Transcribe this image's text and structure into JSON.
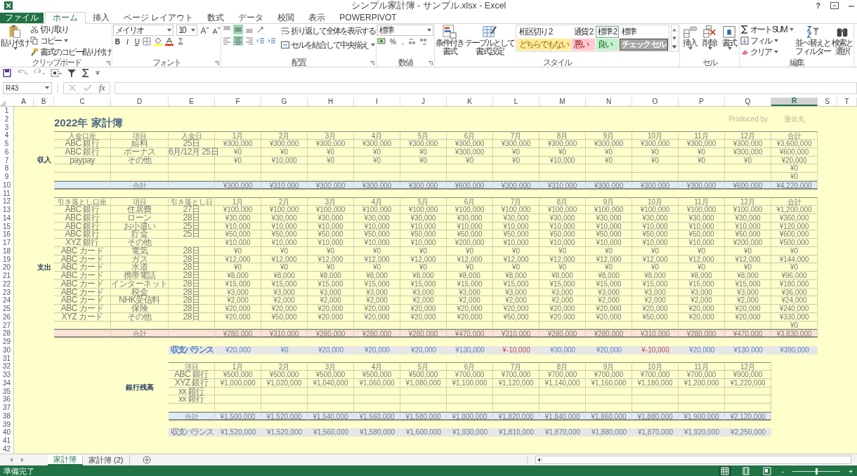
{
  "window": {
    "title": "シンプル家計簿 - サンプル.xlsx - Excel",
    "help": "?"
  },
  "ribbon_tabs": [
    {
      "label": "ファイル",
      "kind": "file",
      "selected": false
    },
    {
      "label": "ホーム",
      "kind": "tab",
      "selected": true
    },
    {
      "label": "挿入",
      "kind": "tab",
      "selected": false
    },
    {
      "label": "ページ レイアウト",
      "kind": "tab",
      "selected": false
    },
    {
      "label": "数式",
      "kind": "tab",
      "selected": false
    },
    {
      "label": "データ",
      "kind": "tab",
      "selected": false
    },
    {
      "label": "校閲",
      "kind": "tab",
      "selected": false
    },
    {
      "label": "表示",
      "kind": "tab",
      "selected": false
    },
    {
      "label": "POWERPIVOT",
      "kind": "tab",
      "selected": false
    }
  ],
  "ribbon": {
    "clipboard": {
      "label": "クリップボード",
      "paste": "貼り付け",
      "cut": "切り取り",
      "copy": "コピー",
      "format_painter": "書式のコピー/貼り付け"
    },
    "font": {
      "label": "フォント",
      "name": "メイリオ",
      "size": "10",
      "bold": "B",
      "italic": "I",
      "underline": "U"
    },
    "alignment": {
      "label": "配置",
      "middle_selected": true,
      "center_selected": true,
      "wrap": "折り返して全体を表示する",
      "merge": "セルを結合して中央揃え"
    },
    "number": {
      "label": "数値",
      "format": "標準",
      "percent": "%",
      "comma": ","
    },
    "styles": {
      "label": "スタイル",
      "conditional": [
        "条件付き",
        "書式"
      ],
      "table": [
        "テーブルとして",
        "書式設定"
      ],
      "gallery": [
        {
          "label": "桁区切り 2",
          "kind": "plain",
          "selected": false
        },
        {
          "label": "通貨 2",
          "kind": "plain",
          "selected": false
        },
        {
          "label": "標準 2",
          "kind": "plain",
          "selected": true
        },
        {
          "label": "標準",
          "kind": "plain",
          "selected": false
        },
        {
          "label": "どちらでもない",
          "kind": "neutral",
          "selected": false
        },
        {
          "label": "悪い",
          "kind": "bad",
          "selected": false
        },
        {
          "label": "良い",
          "kind": "good",
          "selected": false
        },
        {
          "label": "チェック セル",
          "kind": "check",
          "selected": false
        }
      ]
    },
    "cells": {
      "label": "セル",
      "insert": "挿入",
      "delete": "削除",
      "format": "書式"
    },
    "editing": {
      "label": "編集",
      "autosum": "オート SUM",
      "fill": "フィル",
      "clear": "クリア",
      "sort": [
        "並べ替えと",
        "フィルター"
      ],
      "find": [
        "検索と",
        "選択"
      ]
    }
  },
  "formula_bar": {
    "name_box": "R43",
    "fx": "fx"
  },
  "column_headers": [
    {
      "label": "A",
      "selected": false
    },
    {
      "label": "B",
      "selected": false
    },
    {
      "label": "C",
      "selected": false
    },
    {
      "label": "D",
      "selected": false
    },
    {
      "label": "E",
      "selected": false
    },
    {
      "label": "F",
      "selected": false
    },
    {
      "label": "G",
      "selected": false
    },
    {
      "label": "H",
      "selected": false
    },
    {
      "label": "I",
      "selected": false
    },
    {
      "label": "J",
      "selected": false
    },
    {
      "label": "K",
      "selected": false
    },
    {
      "label": "L",
      "selected": false
    },
    {
      "label": "M",
      "selected": false
    },
    {
      "label": "N",
      "selected": false
    },
    {
      "label": "O",
      "selected": false
    },
    {
      "label": "P",
      "selected": false
    },
    {
      "label": "Q",
      "selected": false
    },
    {
      "label": "R",
      "selected": true
    },
    {
      "label": "S",
      "selected": false
    },
    {
      "label": "T",
      "selected": false
    }
  ],
  "row_headers": [
    "1",
    "2",
    "3",
    "4",
    "5",
    "6",
    "7",
    "8",
    "9",
    "10",
    "11",
    "12",
    "13",
    "14",
    "15",
    "16",
    "17",
    "18",
    "19",
    "20",
    "21",
    "22",
    "23",
    "24",
    "25",
    "26",
    "27",
    "28",
    "29",
    "30",
    "31",
    "32",
    "33",
    "34",
    "35",
    "36",
    "37",
    "38",
    "39",
    "40",
    "41",
    "42"
  ],
  "sheet": {
    "title": "2022年 家計簿",
    "credit": [
      "Produced by",
      "蓮佑丸"
    ],
    "income": {
      "label": "収入",
      "columns": [
        "入金口座",
        "項目",
        "入金日",
        "1月",
        "2月",
        "3月",
        "4月",
        "5月",
        "6月",
        "7月",
        "8月",
        "9月",
        "10月",
        "11月",
        "12月",
        "合計"
      ],
      "rows": [
        {
          "account": "ABC 銀行",
          "item": "給料",
          "date": "25日",
          "months": [
            "¥300,000",
            "¥300,000",
            "¥300,000",
            "¥300,000",
            "¥300,000",
            "¥300,000",
            "¥300,000",
            "¥300,000",
            "¥300,000",
            "¥300,000",
            "¥300,000",
            "¥300,000"
          ],
          "total": "¥3,600,000"
        },
        {
          "account": "ABC 銀行",
          "item": "ボーナス",
          "date": "6月/12月 25日",
          "months": [
            "¥0",
            "¥0",
            "¥0",
            "¥0",
            "¥0",
            "¥300,000",
            "¥0",
            "¥0",
            "¥0",
            "¥0",
            "¥0",
            "¥300,000"
          ],
          "total": "¥600,000"
        },
        {
          "account": "paypay",
          "item": "その他",
          "months": [
            "¥0",
            "¥10,000",
            "¥0",
            "¥0",
            "¥0",
            "¥0",
            "¥0",
            "¥10,000",
            "¥0",
            "¥0",
            "¥0",
            "¥0"
          ],
          "total": "¥20,000"
        },
        {
          "total": "¥0"
        },
        {
          "total": "¥0"
        }
      ],
      "total": {
        "item": "合計",
        "months": [
          "¥300,000",
          "¥310,000",
          "¥300,000",
          "¥300,000",
          "¥300,000",
          "¥600,000",
          "¥300,000",
          "¥310,000",
          "¥300,000",
          "¥300,000",
          "¥300,000",
          "¥600,000"
        ],
        "total": "¥4,220,000"
      }
    },
    "expense": {
      "label": "支出",
      "columns": [
        "引き落とし口座",
        "項目",
        "引き落とし日",
        "1月",
        "2月",
        "3月",
        "4月",
        "5月",
        "6月",
        "7月",
        "8月",
        "9月",
        "10月",
        "11月",
        "12月",
        "合計"
      ],
      "rows": [
        {
          "account": "ABC 銀行",
          "item": "住居費",
          "date": "27日",
          "months": [
            "¥100,000",
            "¥100,000",
            "¥100,000",
            "¥100,000",
            "¥100,000",
            "¥100,000",
            "¥100,000",
            "¥100,000",
            "¥100,000",
            "¥100,000",
            "¥100,000",
            "¥100,000"
          ],
          "total": "¥1,200,000"
        },
        {
          "account": "ABC 銀行",
          "item": "ローン",
          "date": "28日",
          "months": [
            "¥30,000",
            "¥30,000",
            "¥30,000",
            "¥30,000",
            "¥30,000",
            "¥30,000",
            "¥30,000",
            "¥30,000",
            "¥30,000",
            "¥30,000",
            "¥30,000",
            "¥30,000"
          ],
          "total": "¥360,000"
        },
        {
          "account": "ABC 銀行",
          "item": "お小遣い",
          "date": "25日",
          "months": [
            "¥10,000",
            "¥10,000",
            "¥10,000",
            "¥10,000",
            "¥10,000",
            "¥10,000",
            "¥10,000",
            "¥10,000",
            "¥10,000",
            "¥10,000",
            "¥10,000",
            "¥10,000"
          ],
          "total": "¥120,000"
        },
        {
          "account": "ABC 銀行",
          "item": "貯金",
          "date": "25日",
          "months": [
            "¥50,000",
            "¥50,000",
            "¥50,000",
            "¥50,000",
            "¥50,000",
            "¥50,000",
            "¥50,000",
            "¥50,000",
            "¥50,000",
            "¥50,000",
            "¥50,000",
            "¥50,000"
          ],
          "total": "¥600,000"
        },
        {
          "account": "XYZ 銀行",
          "item": "その他",
          "months": [
            "¥10,000",
            "¥10,000",
            "¥10,000",
            "¥10,000",
            "¥10,000",
            "¥200,000",
            "¥10,000",
            "¥10,000",
            "¥10,000",
            "¥10,000",
            "¥10,000",
            "¥200,000"
          ],
          "total": "¥500,000"
        },
        {
          "account": "ABC カード",
          "item": "電気",
          "date": "28日",
          "months": [
            "¥0",
            "¥0",
            "¥0",
            "¥0",
            "¥0",
            "¥0",
            "¥0",
            "¥0",
            "¥0",
            "¥0",
            "¥0",
            "¥0"
          ],
          "total": "¥0"
        },
        {
          "account": "ABC カード",
          "item": "ガス",
          "date": "28日",
          "months": [
            "¥12,000",
            "¥12,000",
            "¥12,000",
            "¥12,000",
            "¥12,000",
            "¥12,000",
            "¥12,000",
            "¥12,000",
            "¥12,000",
            "¥12,000",
            "¥12,000",
            "¥12,000"
          ],
          "total": "¥144,000"
        },
        {
          "account": "ABC カード",
          "item": "水道",
          "date": "28日",
          "months": [
            "¥0",
            "¥0",
            "¥0",
            "¥0",
            "¥0",
            "¥0",
            "¥0",
            "¥0",
            "¥0",
            "¥0",
            "¥0",
            "¥0"
          ],
          "total": "¥0"
        },
        {
          "account": "ABC カード",
          "item": "携帯電話",
          "date": "28日",
          "months": [
            "¥8,000",
            "¥8,000",
            "¥8,000",
            "¥8,000",
            "¥8,000",
            "¥8,000",
            "¥8,000",
            "¥8,000",
            "¥8,000",
            "¥8,000",
            "¥8,000",
            "¥8,000"
          ],
          "total": "¥96,000"
        },
        {
          "account": "ABC カード",
          "item": "インターネット",
          "date": "28日",
          "months": [
            "¥15,000",
            "¥15,000",
            "¥15,000",
            "¥15,000",
            "¥15,000",
            "¥15,000",
            "¥15,000",
            "¥15,000",
            "¥15,000",
            "¥15,000",
            "¥15,000",
            "¥15,000"
          ],
          "total": "¥180,000"
        },
        {
          "account": "ABC カード",
          "item": "税金",
          "date": "28日",
          "months": [
            "¥3,000",
            "¥3,000",
            "¥3,000",
            "¥3,000",
            "¥3,000",
            "¥3,000",
            "¥3,000",
            "¥3,000",
            "¥3,000",
            "¥3,000",
            "¥3,000",
            "¥3,000"
          ],
          "total": "¥36,000"
        },
        {
          "account": "ABC カード",
          "item": "NHK受信料",
          "date": "28日",
          "months": [
            "¥2,000",
            "¥2,000",
            "¥2,000",
            "¥2,000",
            "¥2,000",
            "¥2,000",
            "¥2,000",
            "¥2,000",
            "¥2,000",
            "¥2,000",
            "¥2,000",
            "¥2,000"
          ],
          "total": "¥24,000"
        },
        {
          "account": "ABC カード",
          "item": "保険",
          "date": "28日",
          "months": [
            "¥20,000",
            "¥20,000",
            "¥20,000",
            "¥20,000",
            "¥20,000",
            "¥20,000",
            "¥20,000",
            "¥20,000",
            "¥20,000",
            "¥20,000",
            "¥20,000",
            "¥20,000"
          ],
          "total": "¥240,000"
        },
        {
          "account": "XYZ カード",
          "item": "その他",
          "date": "28日",
          "months": [
            "¥20,000",
            "¥50,000",
            "¥20,000",
            "¥20,000",
            "¥20,000",
            "¥20,000",
            "¥50,000",
            "¥20,000",
            "¥20,000",
            "¥50,000",
            "¥20,000",
            "¥20,000"
          ],
          "total": "¥330,000"
        },
        {
          "total": "¥0"
        }
      ],
      "total": {
        "item": "合計",
        "months": [
          "¥280,000",
          "¥310,000",
          "¥280,000",
          "¥280,000",
          "¥280,000",
          "¥470,000",
          "¥310,000",
          "¥280,000",
          "¥280,000",
          "¥310,000",
          "¥280,000",
          "¥470,000"
        ],
        "total": "¥3,830,000"
      }
    },
    "balance": {
      "label": "収支バランス",
      "values": [
        {
          "text": "¥20,000",
          "negative": false
        },
        {
          "text": "¥0",
          "negative": false
        },
        {
          "text": "¥20,000",
          "negative": false
        },
        {
          "text": "¥20,000",
          "negative": false
        },
        {
          "text": "¥20,000",
          "negative": false
        },
        {
          "text": "¥130,000",
          "negative": false
        },
        {
          "text": "¥-10,000",
          "negative": true
        },
        {
          "text": "¥30,000",
          "negative": false
        },
        {
          "text": "¥20,000",
          "negative": false
        },
        {
          "text": "¥-10,000",
          "negative": true
        },
        {
          "text": "¥20,000",
          "negative": false
        },
        {
          "text": "¥130,000",
          "negative": false
        }
      ],
      "total": "¥390,000"
    },
    "bank": {
      "label": "銀行残高",
      "columns": [
        "項目",
        "1月",
        "2月",
        "3月",
        "4月",
        "5月",
        "6月",
        "7月",
        "8月",
        "9月",
        "10月",
        "11月",
        "12月"
      ],
      "rows": [
        {
          "item": "ABC 銀行",
          "months": [
            "¥500,000",
            "¥500,000",
            "¥500,000",
            "¥500,000",
            "¥500,000",
            "¥700,000",
            "¥700,000",
            "¥700,000",
            "¥700,000",
            "¥700,000",
            "¥700,000",
            "¥900,000"
          ]
        },
        {
          "item": "XYZ 銀行",
          "months": [
            "¥1,000,000",
            "¥1,020,000",
            "¥1,040,000",
            "¥1,060,000",
            "¥1,080,000",
            "¥1,100,000",
            "¥1,120,000",
            "¥1,140,000",
            "¥1,160,000",
            "¥1,180,000",
            "¥1,200,000",
            "¥1,220,000"
          ]
        },
        {
          "item": "xx 銀行"
        },
        {
          "item": "xx 銀行"
        }
      ],
      "total": {
        "item": "合計",
        "months": [
          "¥1,500,000",
          "¥1,520,000",
          "¥1,540,000",
          "¥1,560,000",
          "¥1,580,000",
          "¥1,800,000",
          "¥1,820,000",
          "¥1,840,000",
          "¥1,860,000",
          "¥1,880,000",
          "¥1,900,000",
          "¥2,120,000"
        ]
      },
      "balance": {
        "item": "収支バランス",
        "months": [
          "¥1,520,000",
          "¥1,520,000",
          "¥1,560,000",
          "¥1,580,000",
          "¥1,600,000",
          "¥1,930,000",
          "¥1,810,000",
          "¥1,870,000",
          "¥1,880,000",
          "¥1,870,000",
          "¥1,920,000",
          "¥2,250,000"
        ]
      }
    }
  },
  "sheet_tabs": [
    {
      "label": "家計簿",
      "selected": true
    },
    {
      "label": "家計簿 (2)",
      "selected": false
    }
  ],
  "status_bar": {
    "text": "準備完了",
    "zoom_out": "-",
    "zoom_in": "+",
    "zoom": {
      "level": 0.5
    }
  }
}
